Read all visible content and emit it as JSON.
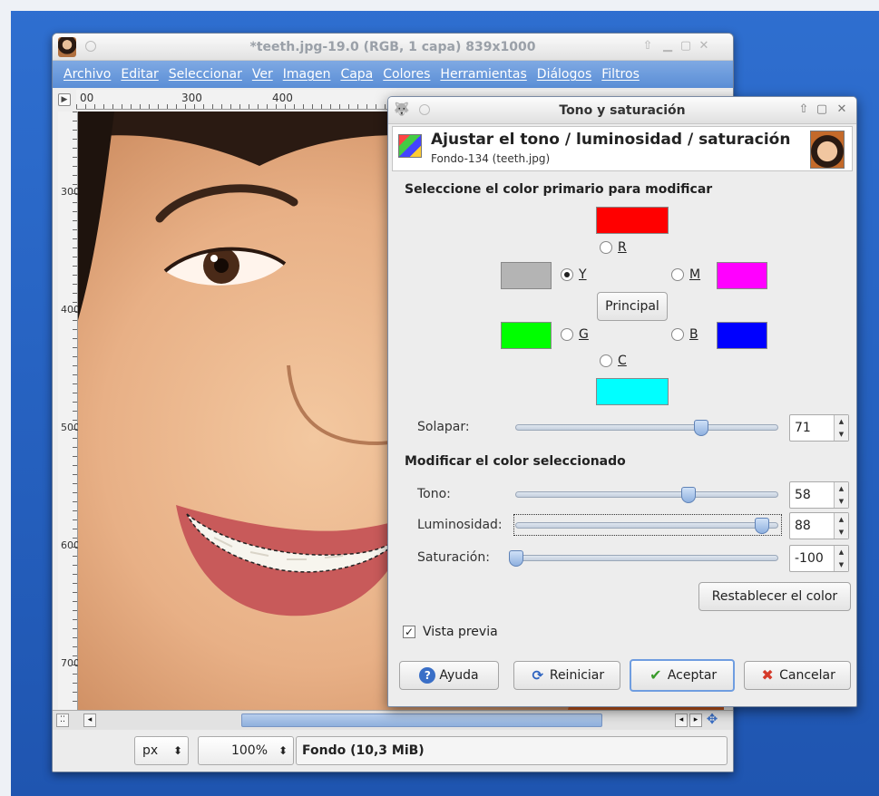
{
  "image_window": {
    "title": "*teeth.jpg-19.0 (RGB, 1 capa) 839x1000",
    "menu": [
      "Archivo",
      "Editar",
      "Seleccionar",
      "Ver",
      "Imagen",
      "Capa",
      "Colores",
      "Herramientas",
      "Diálogos",
      "Filtros"
    ],
    "ruler_h": [
      "00",
      "300",
      "400"
    ],
    "ruler_v": [
      "300",
      "400",
      "500",
      "600",
      "700"
    ],
    "unit": "px",
    "zoom": "100%",
    "status": "Fondo (10,3 MiB)"
  },
  "dialog": {
    "title": "Tono y saturación",
    "header_title": "Ajustar el tono / luminosidad / saturación",
    "header_subtitle": "Fondo-134 (teeth.jpg)",
    "select_title": "Seleccione el color primario para modificar",
    "radios": {
      "R": "R",
      "Y": "Y",
      "M": "M",
      "G": "G",
      "B": "B",
      "C": "C"
    },
    "selected": "Y",
    "master_button": "Principal",
    "overlap": {
      "label": "Solapar:",
      "value": "71",
      "level": 71
    },
    "modify_title": "Modificar el color seleccionado",
    "hue": {
      "label": "Tono:",
      "value": "58",
      "level": 58
    },
    "lightness": {
      "label": "Luminosidad:",
      "value": "88",
      "level": 88
    },
    "saturation": {
      "label": "Saturación:",
      "value": "-100",
      "level": -100
    },
    "reset_color_button": "Restablecer el color",
    "preview_label": "Vista previa",
    "buttons": {
      "help": "Ayuda",
      "reset": "Reiniciar",
      "ok": "Aceptar",
      "cancel": "Cancelar"
    }
  },
  "colors": {
    "red": "#ff0000",
    "yellow_gray": "#b4b4b4",
    "magenta": "#ff00ff",
    "green": "#00ff00",
    "blue": "#0000ff",
    "cyan": "#00ffff",
    "menubar": "#5a8ed6"
  }
}
